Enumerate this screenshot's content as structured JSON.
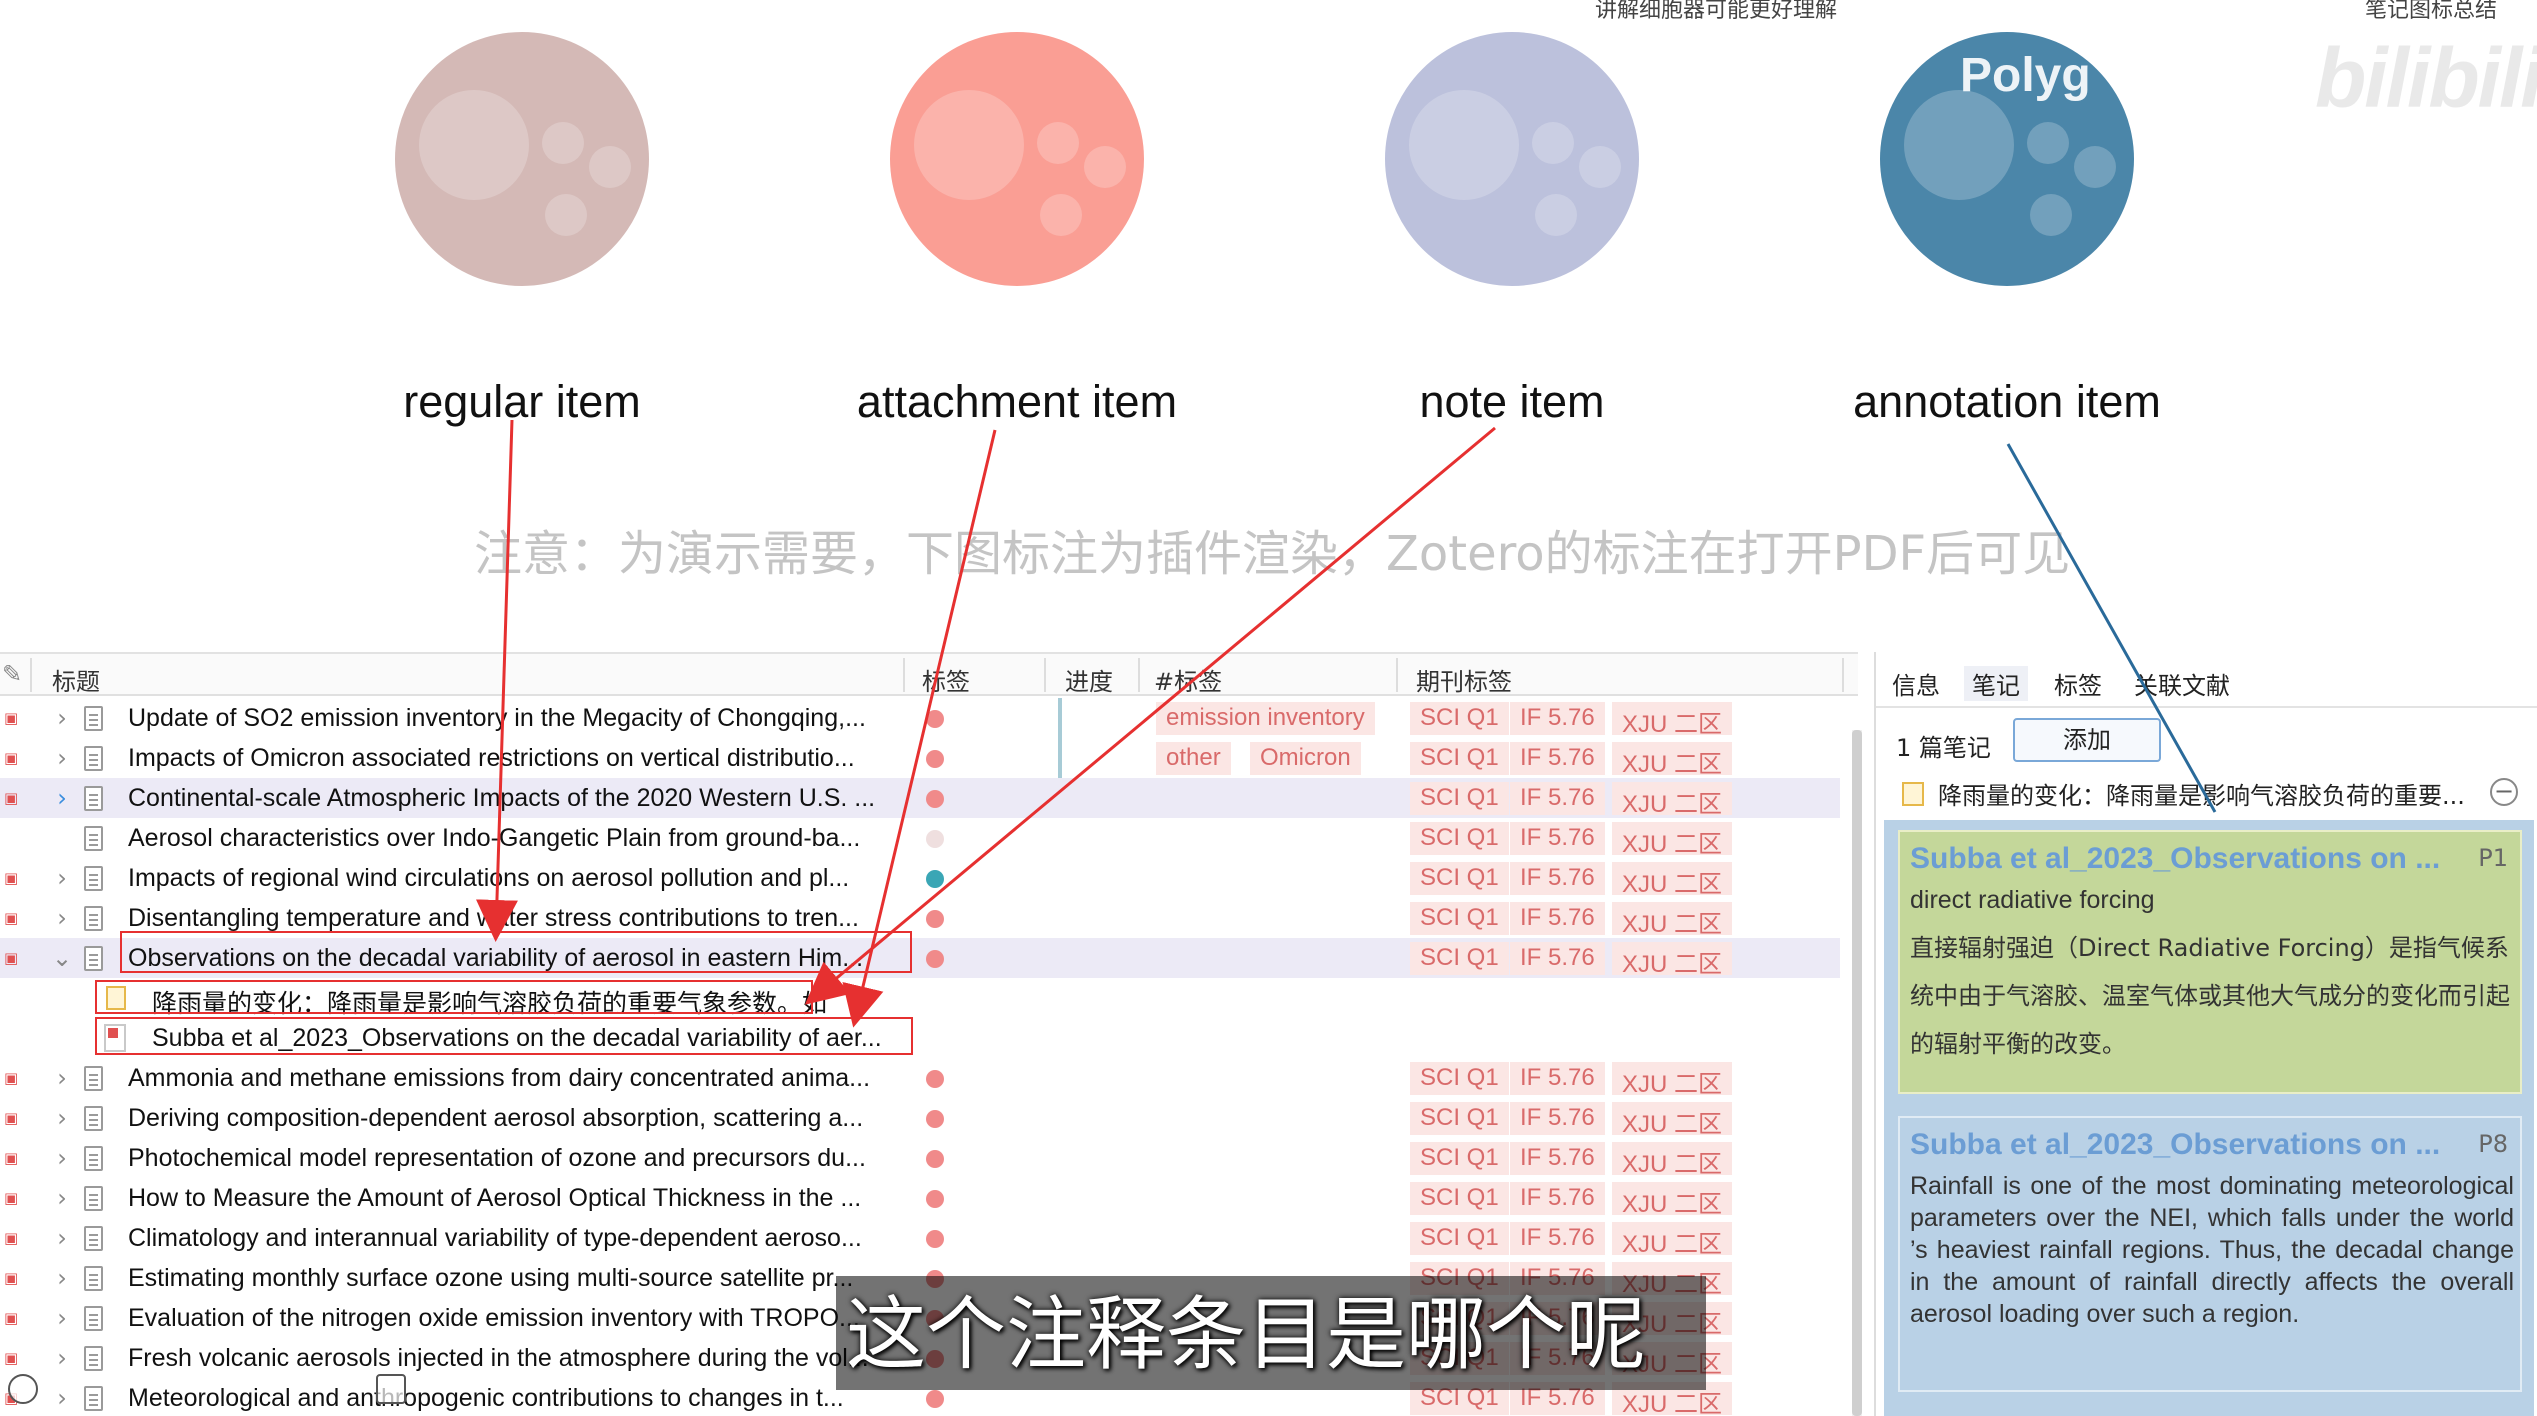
{
  "top_clipped": [
    "讲解细胞器可能更好理解",
    "笔记图标总结"
  ],
  "watermark": "Polyg",
  "bilibili_logo": "bilibili",
  "captions": [
    "regular item",
    "attachment item",
    "note item",
    "annotation item"
  ],
  "notice": "注意：为演示需要，下图标注为插件渲染，Zotero的标注在打开PDF后可见",
  "list": {
    "headers": {
      "title": "标题",
      "tags": "标签",
      "progress": "进度",
      "hashtag": "#标签",
      "journal": "期刊标签"
    },
    "rows": [
      {
        "title": "Update of SO2 emission inventory in the Megacity of Chongqing,...",
        "dot": "#f08a8a",
        "tags": [
          "emission inventory"
        ],
        "jt": [
          "SCI Q1",
          "IF 5.76",
          "XJU 二区"
        ],
        "prog": true,
        "chev": ">"
      },
      {
        "title": "Impacts of Omicron associated restrictions on vertical distributio...",
        "dot": "#f08a8a",
        "tags": [
          "other",
          "Omicron"
        ],
        "jt": [
          "SCI Q1",
          "IF 5.76",
          "XJU 二区"
        ],
        "prog": true,
        "chev": ">"
      },
      {
        "title": "Continental-scale Atmospheric Impacts of the 2020 Western U.S. ...",
        "dot": "#f08a8a",
        "tags": [],
        "jt": [
          "SCI Q1",
          "IF 5.76",
          "XJU 二区"
        ],
        "sel": true,
        "chev": ">"
      },
      {
        "title": "Aerosol characteristics over Indo-Gangetic Plain from ground-ba...",
        "dot": "#efdfdf",
        "tags": [],
        "jt": [
          "SCI Q1",
          "IF 5.76",
          "XJU 二区"
        ],
        "noatt": true,
        "chev": ""
      },
      {
        "title": "Impacts of regional wind circulations on aerosol pollution and pl...",
        "dot": "#3aa6b5",
        "tags": [],
        "jt": [
          "SCI Q1",
          "IF 5.76",
          "XJU 二区"
        ],
        "chev": ">"
      },
      {
        "title": "Disentangling temperature and water stress contributions to tren...",
        "dot": "#f08a8a",
        "tags": [],
        "jt": [
          "SCI Q1",
          "IF 5.76",
          "XJU 二区"
        ],
        "chev": ">"
      },
      {
        "title": "Observations on the decadal variability of aerosol in eastern Him...",
        "dot": "#f08a8a",
        "tags": [],
        "jt": [
          "SCI Q1",
          "IF 5.76",
          "XJU 二区"
        ],
        "sel": true,
        "chev": "v"
      }
    ],
    "children": [
      {
        "kind": "note",
        "text": "降雨量的变化：降雨量是影响气溶胶负荷的重要气象参数。如"
      },
      {
        "kind": "pdf",
        "text": "Subba et al_2023_Observations on the decadal variability of aer..."
      }
    ],
    "rows2": [
      {
        "title": "Ammonia and methane emissions from dairy concentrated anima...",
        "dot": "#f08a8a",
        "jt": [
          "SCI Q1",
          "IF 5.76",
          "XJU 二区"
        ]
      },
      {
        "title": "Deriving composition-dependent aerosol absorption, scattering a...",
        "dot": "#f08a8a",
        "jt": [
          "SCI Q1",
          "IF 5.76",
          "XJU 二区"
        ]
      },
      {
        "title": "Photochemical model representation of ozone and precursors du...",
        "dot": "#f08a8a",
        "jt": [
          "SCI Q1",
          "IF 5.76",
          "XJU 二区"
        ]
      },
      {
        "title": "How to Measure the Amount of Aerosol Optical Thickness in the ...",
        "dot": "#f08a8a",
        "jt": [
          "SCI Q1",
          "IF 5.76",
          "XJU 二区"
        ]
      },
      {
        "title": "Climatology and interannual variability of type-dependent aeroso...",
        "dot": "#f08a8a",
        "jt": [
          "SCI Q1",
          "IF 5.76",
          "XJU 二区"
        ]
      },
      {
        "title": "Estimating monthly surface ozone using multi-source satellite pr...",
        "dot": "#f08a8a",
        "jt": [
          "SCI Q1",
          "IF 5.76",
          "XJU 二区"
        ]
      },
      {
        "title": "Evaluation of the nitrogen oxide emission inventory with TROPO...",
        "dot": "#f08a8a",
        "jt": [
          "SCI Q1",
          "IF 5.76",
          "XJU 二区"
        ]
      },
      {
        "title": "Fresh volcanic aerosols injected in the atmosphere during the vol...",
        "dot": "#f08a8a",
        "jt": [
          "SCI Q1",
          "IF 5.76",
          "XJU 二区"
        ]
      },
      {
        "title": "Meteorological and anthropogenic contributions to changes in t...",
        "dot": "#f08a8a",
        "jt": [
          "SCI Q1",
          "IF 5.76",
          "XJU 二区"
        ]
      }
    ]
  },
  "right": {
    "tabs": [
      "信息",
      "笔记",
      "标签",
      "关联文献"
    ],
    "notes_count": "1 篇笔记",
    "add_label": "添加",
    "note_line": "降雨量的变化：降雨量是影响气溶胶负荷的重要...",
    "card1": {
      "title": "Subba et al_2023_Observations on ...",
      "page": "P1",
      "sub": "direct radiative forcing",
      "body": "直接辐射强迫（Direct Radiative Forcing）是指气候系统中由于气溶胶、温室气体或其他大气成分的变化而引起的辐射平衡的改变。"
    },
    "card2": {
      "title": "Subba et al_2023_Observations on ...",
      "page": "P8",
      "body": "Rainfall is one of the most dominating meteorological parameters over the NEI, which falls under the world ’s heaviest rainfall regions. Thus, the decadal change in the amount of rainfall directly affects the overall aerosol loading over such a region."
    }
  },
  "subtitle": "这个注释条目是哪个呢",
  "colors": {
    "regular": "#d4b9b6",
    "attachment": "#fa9e94",
    "note": "#bcc1dc",
    "annotation": "#4b86a9",
    "arrow_red": "#e63030",
    "arrow_blue": "#2a6a9a"
  }
}
